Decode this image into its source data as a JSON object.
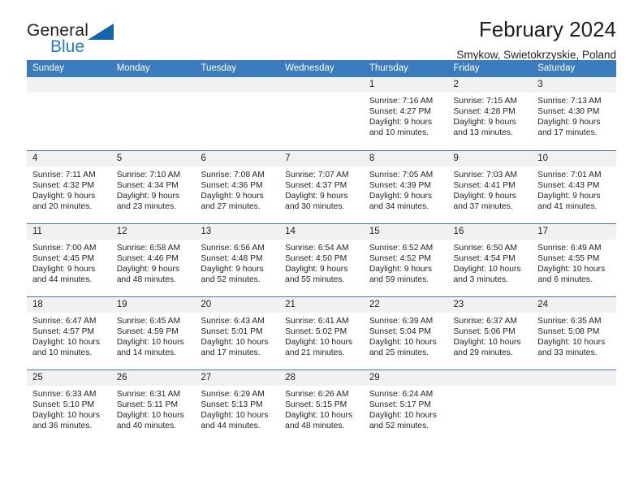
{
  "brand": {
    "name_top": "General",
    "name_bottom": "Blue",
    "triangle_color": "#1565ad",
    "blue_color": "#1b7fc4"
  },
  "header": {
    "title": "February 2024",
    "subtitle": "Smykow, Swietokrzyskie, Poland"
  },
  "theme": {
    "header_bg": "#3a7cbe",
    "daynum_bg": "#f1f1f1",
    "text": "#231f20"
  },
  "weekday_headers": [
    "Sunday",
    "Monday",
    "Tuesday",
    "Wednesday",
    "Thursday",
    "Friday",
    "Saturday"
  ],
  "labels": {
    "sunrise_prefix": "Sunrise:",
    "sunset_prefix": "Sunset:",
    "daylight_prefix": "Daylight:"
  },
  "weeks": [
    [
      {
        "day": "",
        "sunrise": "",
        "sunset": "",
        "daylight_line1": "",
        "daylight_line2": "",
        "empty": true
      },
      {
        "day": "",
        "sunrise": "",
        "sunset": "",
        "daylight_line1": "",
        "daylight_line2": "",
        "empty": true
      },
      {
        "day": "",
        "sunrise": "",
        "sunset": "",
        "daylight_line1": "",
        "daylight_line2": "",
        "empty": true
      },
      {
        "day": "",
        "sunrise": "",
        "sunset": "",
        "daylight_line1": "",
        "daylight_line2": "",
        "empty": true
      },
      {
        "day": "1",
        "sunrise": "Sunrise: 7:16 AM",
        "sunset": "Sunset: 4:27 PM",
        "daylight_line1": "Daylight: 9 hours",
        "daylight_line2": "and 10 minutes."
      },
      {
        "day": "2",
        "sunrise": "Sunrise: 7:15 AM",
        "sunset": "Sunset: 4:28 PM",
        "daylight_line1": "Daylight: 9 hours",
        "daylight_line2": "and 13 minutes."
      },
      {
        "day": "3",
        "sunrise": "Sunrise: 7:13 AM",
        "sunset": "Sunset: 4:30 PM",
        "daylight_line1": "Daylight: 9 hours",
        "daylight_line2": "and 17 minutes."
      }
    ],
    [
      {
        "day": "4",
        "sunrise": "Sunrise: 7:11 AM",
        "sunset": "Sunset: 4:32 PM",
        "daylight_line1": "Daylight: 9 hours",
        "daylight_line2": "and 20 minutes."
      },
      {
        "day": "5",
        "sunrise": "Sunrise: 7:10 AM",
        "sunset": "Sunset: 4:34 PM",
        "daylight_line1": "Daylight: 9 hours",
        "daylight_line2": "and 23 minutes."
      },
      {
        "day": "6",
        "sunrise": "Sunrise: 7:08 AM",
        "sunset": "Sunset: 4:36 PM",
        "daylight_line1": "Daylight: 9 hours",
        "daylight_line2": "and 27 minutes."
      },
      {
        "day": "7",
        "sunrise": "Sunrise: 7:07 AM",
        "sunset": "Sunset: 4:37 PM",
        "daylight_line1": "Daylight: 9 hours",
        "daylight_line2": "and 30 minutes."
      },
      {
        "day": "8",
        "sunrise": "Sunrise: 7:05 AM",
        "sunset": "Sunset: 4:39 PM",
        "daylight_line1": "Daylight: 9 hours",
        "daylight_line2": "and 34 minutes."
      },
      {
        "day": "9",
        "sunrise": "Sunrise: 7:03 AM",
        "sunset": "Sunset: 4:41 PM",
        "daylight_line1": "Daylight: 9 hours",
        "daylight_line2": "and 37 minutes."
      },
      {
        "day": "10",
        "sunrise": "Sunrise: 7:01 AM",
        "sunset": "Sunset: 4:43 PM",
        "daylight_line1": "Daylight: 9 hours",
        "daylight_line2": "and 41 minutes."
      }
    ],
    [
      {
        "day": "11",
        "sunrise": "Sunrise: 7:00 AM",
        "sunset": "Sunset: 4:45 PM",
        "daylight_line1": "Daylight: 9 hours",
        "daylight_line2": "and 44 minutes."
      },
      {
        "day": "12",
        "sunrise": "Sunrise: 6:58 AM",
        "sunset": "Sunset: 4:46 PM",
        "daylight_line1": "Daylight: 9 hours",
        "daylight_line2": "and 48 minutes."
      },
      {
        "day": "13",
        "sunrise": "Sunrise: 6:56 AM",
        "sunset": "Sunset: 4:48 PM",
        "daylight_line1": "Daylight: 9 hours",
        "daylight_line2": "and 52 minutes."
      },
      {
        "day": "14",
        "sunrise": "Sunrise: 6:54 AM",
        "sunset": "Sunset: 4:50 PM",
        "daylight_line1": "Daylight: 9 hours",
        "daylight_line2": "and 55 minutes."
      },
      {
        "day": "15",
        "sunrise": "Sunrise: 6:52 AM",
        "sunset": "Sunset: 4:52 PM",
        "daylight_line1": "Daylight: 9 hours",
        "daylight_line2": "and 59 minutes."
      },
      {
        "day": "16",
        "sunrise": "Sunrise: 6:50 AM",
        "sunset": "Sunset: 4:54 PM",
        "daylight_line1": "Daylight: 10 hours",
        "daylight_line2": "and 3 minutes."
      },
      {
        "day": "17",
        "sunrise": "Sunrise: 6:49 AM",
        "sunset": "Sunset: 4:55 PM",
        "daylight_line1": "Daylight: 10 hours",
        "daylight_line2": "and 6 minutes."
      }
    ],
    [
      {
        "day": "18",
        "sunrise": "Sunrise: 6:47 AM",
        "sunset": "Sunset: 4:57 PM",
        "daylight_line1": "Daylight: 10 hours",
        "daylight_line2": "and 10 minutes."
      },
      {
        "day": "19",
        "sunrise": "Sunrise: 6:45 AM",
        "sunset": "Sunset: 4:59 PM",
        "daylight_line1": "Daylight: 10 hours",
        "daylight_line2": "and 14 minutes."
      },
      {
        "day": "20",
        "sunrise": "Sunrise: 6:43 AM",
        "sunset": "Sunset: 5:01 PM",
        "daylight_line1": "Daylight: 10 hours",
        "daylight_line2": "and 17 minutes."
      },
      {
        "day": "21",
        "sunrise": "Sunrise: 6:41 AM",
        "sunset": "Sunset: 5:02 PM",
        "daylight_line1": "Daylight: 10 hours",
        "daylight_line2": "and 21 minutes."
      },
      {
        "day": "22",
        "sunrise": "Sunrise: 6:39 AM",
        "sunset": "Sunset: 5:04 PM",
        "daylight_line1": "Daylight: 10 hours",
        "daylight_line2": "and 25 minutes."
      },
      {
        "day": "23",
        "sunrise": "Sunrise: 6:37 AM",
        "sunset": "Sunset: 5:06 PM",
        "daylight_line1": "Daylight: 10 hours",
        "daylight_line2": "and 29 minutes."
      },
      {
        "day": "24",
        "sunrise": "Sunrise: 6:35 AM",
        "sunset": "Sunset: 5:08 PM",
        "daylight_line1": "Daylight: 10 hours",
        "daylight_line2": "and 33 minutes."
      }
    ],
    [
      {
        "day": "25",
        "sunrise": "Sunrise: 6:33 AM",
        "sunset": "Sunset: 5:10 PM",
        "daylight_line1": "Daylight: 10 hours",
        "daylight_line2": "and 36 minutes."
      },
      {
        "day": "26",
        "sunrise": "Sunrise: 6:31 AM",
        "sunset": "Sunset: 5:11 PM",
        "daylight_line1": "Daylight: 10 hours",
        "daylight_line2": "and 40 minutes."
      },
      {
        "day": "27",
        "sunrise": "Sunrise: 6:29 AM",
        "sunset": "Sunset: 5:13 PM",
        "daylight_line1": "Daylight: 10 hours",
        "daylight_line2": "and 44 minutes."
      },
      {
        "day": "28",
        "sunrise": "Sunrise: 6:26 AM",
        "sunset": "Sunset: 5:15 PM",
        "daylight_line1": "Daylight: 10 hours",
        "daylight_line2": "and 48 minutes."
      },
      {
        "day": "29",
        "sunrise": "Sunrise: 6:24 AM",
        "sunset": "Sunset: 5:17 PM",
        "daylight_line1": "Daylight: 10 hours",
        "daylight_line2": "and 52 minutes."
      },
      {
        "day": "",
        "sunrise": "",
        "sunset": "",
        "daylight_line1": "",
        "daylight_line2": "",
        "empty": true
      },
      {
        "day": "",
        "sunrise": "",
        "sunset": "",
        "daylight_line1": "",
        "daylight_line2": "",
        "empty": true
      }
    ]
  ]
}
